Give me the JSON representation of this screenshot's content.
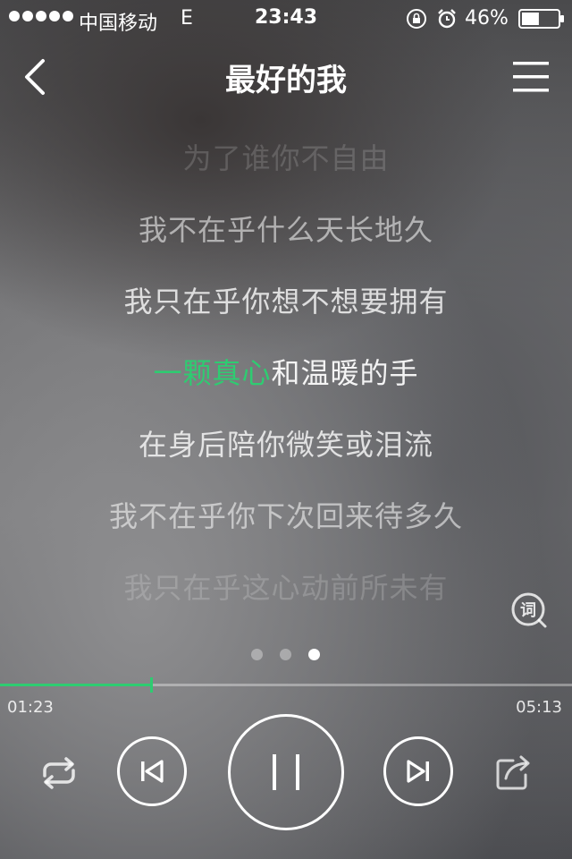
{
  "status_bar": {
    "carrier": "中国移动",
    "network": "E",
    "time": "23:43",
    "battery": "46%",
    "battery_level": 0.46
  },
  "header": {
    "title": "最好的我",
    "back_icon": "chevron-left-icon",
    "menu_icon": "hamburger-menu-icon"
  },
  "lyrics": {
    "lines": [
      "为了谁你不自由",
      "我不在乎什么天长地久",
      "我只在乎你想不想要拥有",
      "和温暖的手",
      "在身后陪你微笑或泪流",
      "我不在乎你下次回来待多久",
      "我只在乎这心动前所未有"
    ],
    "current_highlight": "一颗真心",
    "highlight_color": "#2ecc71",
    "toggle_label": "词"
  },
  "pager": {
    "count": 3,
    "active": 3
  },
  "playback": {
    "elapsed": "01:23",
    "total": "05:13",
    "progress": 0.265,
    "accent": "#2ecc71"
  },
  "controls": {
    "repeat_icon": "repeat-icon",
    "prev_icon": "skip-previous-icon",
    "play_icon": "pause-icon",
    "next_icon": "skip-next-icon",
    "share_icon": "share-icon"
  }
}
